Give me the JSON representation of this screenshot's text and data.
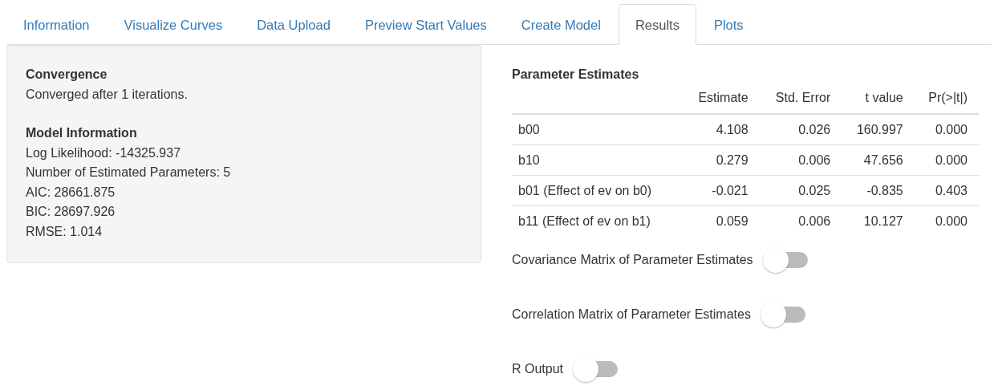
{
  "tabs": [
    {
      "label": "Information",
      "selected": false
    },
    {
      "label": "Visualize Curves",
      "selected": false
    },
    {
      "label": "Data Upload",
      "selected": false
    },
    {
      "label": "Preview Start Values",
      "selected": false
    },
    {
      "label": "Create Model",
      "selected": false
    },
    {
      "label": "Results",
      "selected": true
    },
    {
      "label": "Plots",
      "selected": false
    }
  ],
  "summary_panel": {
    "sections": [
      {
        "heading": "Convergence",
        "lines": [
          "Converged after 1 iterations."
        ]
      },
      {
        "heading": "Model Information",
        "lines": [
          "Log Likelihood: -14325.937",
          "Number of Estimated Parameters: 5",
          "AIC: 28661.875",
          "BIC: 28697.926",
          "RMSE: 1.014"
        ]
      }
    ]
  },
  "parameter_table": {
    "title": "Parameter Estimates",
    "columns": [
      "",
      "Estimate",
      "Std. Error",
      "t value",
      "Pr(>|t|)"
    ],
    "rows": [
      [
        "b00",
        "4.108",
        "0.026",
        "160.997",
        "0.000"
      ],
      [
        "b10",
        "0.279",
        "0.006",
        "47.656",
        "0.000"
      ],
      [
        "b01 (Effect of ev on b0)",
        "-0.021",
        "0.025",
        "-0.835",
        "0.403"
      ],
      [
        "b11 (Effect of ev on b1)",
        "0.059",
        "0.006",
        "10.127",
        "0.000"
      ]
    ]
  },
  "toggles": [
    {
      "label": "Covariance Matrix of Parameter Estimates",
      "on": false
    },
    {
      "label": "Correlation Matrix of Parameter Estimates",
      "on": false
    },
    {
      "label": "R Output",
      "on": false
    }
  ]
}
